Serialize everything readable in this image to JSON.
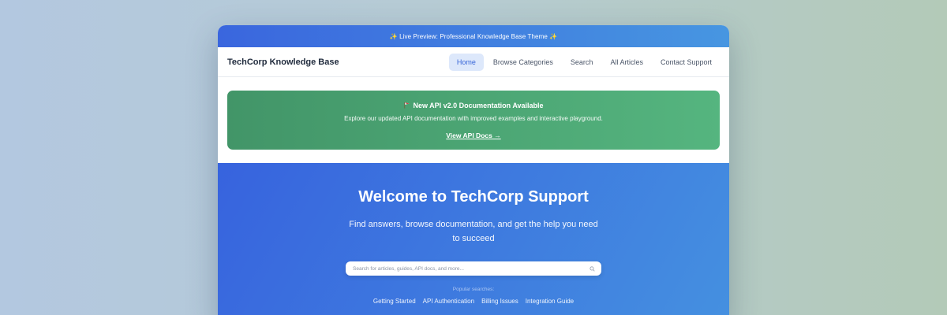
{
  "preview_bar": {
    "text": "✨ Live Preview: Professional Knowledge Base Theme ✨"
  },
  "navbar": {
    "brand": "TechCorp Knowledge Base",
    "links": [
      {
        "label": "Home",
        "active": true
      },
      {
        "label": "Browse Categories",
        "active": false
      },
      {
        "label": "Search",
        "active": false
      },
      {
        "label": "All Articles",
        "active": false
      },
      {
        "label": "Contact Support",
        "active": false
      }
    ]
  },
  "announcement": {
    "icon": "flag-icon",
    "title": "New API v2.0 Documentation Available",
    "text": "Explore our updated API documentation with improved examples and interactive playground.",
    "link": "View API Docs →"
  },
  "hero": {
    "title": "Welcome to TechCorp Support",
    "subtitle": "Find answers, browse documentation, and get the help you need to succeed",
    "search": {
      "placeholder": "Search for articles, guides, API docs, and more...",
      "icon": "search-icon"
    },
    "popular_label": "Popular searches:",
    "popular_links": [
      "Getting Started",
      "API Authentication",
      "Billing Issues",
      "Integration Guide"
    ]
  },
  "colors": {
    "accent": "#3866d8",
    "announcement_green": "#4aa574",
    "hero_blue": "#3d78df"
  }
}
